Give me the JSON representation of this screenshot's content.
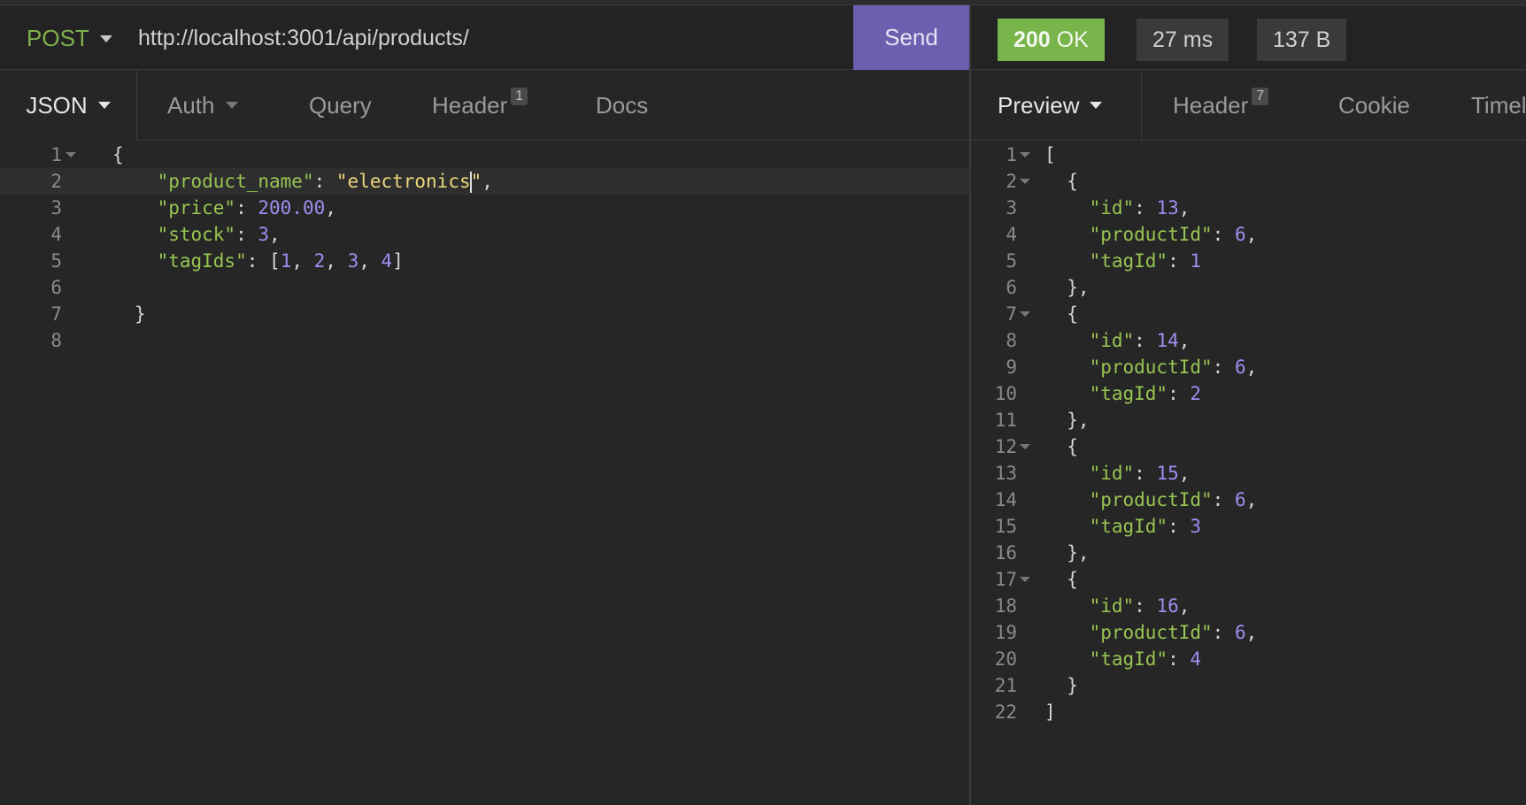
{
  "request": {
    "method": "POST",
    "url": "http://localhost:3001/api/products/",
    "send_label": "Send",
    "tabs": [
      {
        "label": "JSON"
      },
      {
        "label": "Auth"
      },
      {
        "label": "Query"
      },
      {
        "label": "Header",
        "badge": "1"
      },
      {
        "label": "Docs"
      }
    ],
    "body_lines": [
      {
        "num": "1",
        "text": "{"
      },
      {
        "num": "2",
        "key": "\"product_name\"",
        "value": "\"electronics",
        "after": "\","
      },
      {
        "num": "3",
        "key": "\"price\"",
        "value": "200.00",
        "after": ","
      },
      {
        "num": "4",
        "key": "\"stock\"",
        "value": "3",
        "after": ","
      },
      {
        "num": "5",
        "key": "\"tagIds\"",
        "array": [
          "1",
          "2",
          "3",
          "4"
        ]
      },
      {
        "num": "6",
        "text": ""
      },
      {
        "num": "7",
        "text": "}"
      },
      {
        "num": "8",
        "text": ""
      }
    ]
  },
  "response": {
    "status_code": "200",
    "status_text": "OK",
    "time": "27 ms",
    "size": "137 B",
    "tabs": [
      {
        "label": "Preview"
      },
      {
        "label": "Header",
        "badge": "7"
      },
      {
        "label": "Cookie"
      },
      {
        "label": "Timel"
      }
    ],
    "body_lines": [
      {
        "num": "1",
        "text": "["
      },
      {
        "num": "2",
        "text": "  {"
      },
      {
        "num": "3",
        "key": "\"id\"",
        "value": "13",
        "after": ","
      },
      {
        "num": "4",
        "key": "\"productId\"",
        "value": "6",
        "after": ","
      },
      {
        "num": "5",
        "key": "\"tagId\"",
        "value": "1",
        "after": ""
      },
      {
        "num": "6",
        "text": "  },"
      },
      {
        "num": "7",
        "text": "  {"
      },
      {
        "num": "8",
        "key": "\"id\"",
        "value": "14",
        "after": ","
      },
      {
        "num": "9",
        "key": "\"productId\"",
        "value": "6",
        "after": ","
      },
      {
        "num": "10",
        "key": "\"tagId\"",
        "value": "2",
        "after": ""
      },
      {
        "num": "11",
        "text": "  },"
      },
      {
        "num": "12",
        "text": "  {"
      },
      {
        "num": "13",
        "key": "\"id\"",
        "value": "15",
        "after": ","
      },
      {
        "num": "14",
        "key": "\"productId\"",
        "value": "6",
        "after": ","
      },
      {
        "num": "15",
        "key": "\"tagId\"",
        "value": "3",
        "after": ""
      },
      {
        "num": "16",
        "text": "  },"
      },
      {
        "num": "17",
        "text": "  {"
      },
      {
        "num": "18",
        "key": "\"id\"",
        "value": "16",
        "after": ","
      },
      {
        "num": "19",
        "key": "\"productId\"",
        "value": "6",
        "after": ","
      },
      {
        "num": "20",
        "key": "\"tagId\"",
        "value": "4",
        "after": ""
      },
      {
        "num": "21",
        "text": "  }"
      },
      {
        "num": "22",
        "text": "]"
      }
    ]
  },
  "colors": {
    "send_button": "#6d5fb0",
    "status_ok": "#77b44a",
    "method": "#7fb24b",
    "json_key": "#98c552",
    "json_string": "#ecd77a",
    "json_number": "#9b8ff0"
  }
}
